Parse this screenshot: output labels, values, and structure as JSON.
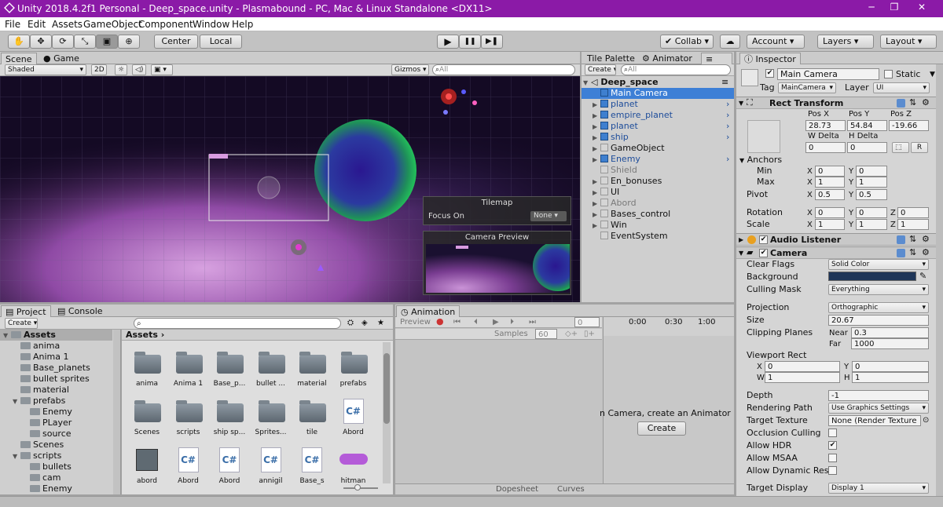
{
  "window": {
    "title": "Unity 2018.4.2f1 Personal - Deep_space.unity - Plasmabound - PC, Mac & Linux Standalone <DX11>",
    "minimize": "─",
    "restore": "❐",
    "close": "✕"
  },
  "menu": [
    "File",
    "Edit",
    "Assets",
    "GameObject",
    "Component",
    "Window",
    "Help"
  ],
  "toolbar": {
    "tools": [
      "✋",
      "✥",
      "⟳",
      "⤡",
      "▣",
      "⊕"
    ],
    "center": "Center",
    "local": "Local",
    "play": "▶",
    "pause": "❚❚",
    "step": "▶❚",
    "collab": "Collab",
    "account": "Account",
    "layers": "Layers",
    "layout": "Layout"
  },
  "scene": {
    "tab_scene": "Scene",
    "tab_game": "Game",
    "shading": "Shaded",
    "mode2d": "2D",
    "gizmos": "Gizmos",
    "search": "All",
    "tilemap_title": "Tilemap",
    "focus_on": "Focus On",
    "focus_value": "None",
    "camera_preview": "Camera Preview"
  },
  "hierarchy": {
    "tab_tile": "Tile Palette",
    "tab_animator": "Animator",
    "tab_hier": "Hierarchy",
    "create": "Create",
    "search": "All",
    "scene": "Deep_space",
    "items": [
      {
        "name": "Main Camera",
        "sel": true,
        "blue": true,
        "arrow": false
      },
      {
        "name": "planet",
        "blue": true,
        "arrow": true,
        "ra": true
      },
      {
        "name": "empire_planet",
        "blue": true,
        "arrow": true,
        "ra": true
      },
      {
        "name": "planet",
        "blue": true,
        "arrow": true,
        "ra": true
      },
      {
        "name": "ship",
        "blue": true,
        "arrow": true,
        "ra": true
      },
      {
        "name": "GameObject",
        "arrow": true
      },
      {
        "name": "Enemy",
        "blue": true,
        "arrow": true,
        "ra": true
      },
      {
        "name": "Shield",
        "dim": true,
        "arrow": false
      },
      {
        "name": "En_bonuses",
        "arrow": true
      },
      {
        "name": "UI",
        "arrow": true
      },
      {
        "name": "Abord",
        "dim": true,
        "arrow": true
      },
      {
        "name": "Bases_control",
        "arrow": true
      },
      {
        "name": "Win",
        "arrow": true
      },
      {
        "name": "EventSystem",
        "arrow": false
      }
    ]
  },
  "project": {
    "tab_project": "Project",
    "tab_console": "Console",
    "create": "Create",
    "breadcrumb": "Assets",
    "tree": [
      {
        "name": "Assets",
        "level": 0,
        "open": true,
        "sel": true
      },
      {
        "name": "anima",
        "level": 1
      },
      {
        "name": "Anima 1",
        "level": 1
      },
      {
        "name": "Base_planets",
        "level": 1
      },
      {
        "name": "bullet sprites",
        "level": 1
      },
      {
        "name": "material",
        "level": 1
      },
      {
        "name": "prefabs",
        "level": 1,
        "open": true
      },
      {
        "name": "Enemy",
        "level": 2
      },
      {
        "name": "PLayer",
        "level": 2
      },
      {
        "name": "source",
        "level": 2
      },
      {
        "name": "Scenes",
        "level": 1
      },
      {
        "name": "scripts",
        "level": 1,
        "open": true
      },
      {
        "name": "bullets",
        "level": 2
      },
      {
        "name": "cam",
        "level": 2
      },
      {
        "name": "Enemy",
        "level": 2
      }
    ],
    "grid": [
      {
        "label": "anima",
        "kind": "folder"
      },
      {
        "label": "Anima 1",
        "kind": "folder"
      },
      {
        "label": "Base_p...",
        "kind": "folder"
      },
      {
        "label": "bullet ...",
        "kind": "folder"
      },
      {
        "label": "material",
        "kind": "folder"
      },
      {
        "label": "prefabs",
        "kind": "folder"
      },
      {
        "label": "Scenes",
        "kind": "folder"
      },
      {
        "label": "scripts",
        "kind": "folder"
      },
      {
        "label": "ship sp...",
        "kind": "folder"
      },
      {
        "label": "Sprites...",
        "kind": "folder"
      },
      {
        "label": "tile",
        "kind": "folder"
      },
      {
        "label": "Abord",
        "kind": "cs"
      },
      {
        "label": "abord",
        "kind": "img"
      },
      {
        "label": "Abord",
        "kind": "cs"
      },
      {
        "label": "Abord",
        "kind": "cs"
      },
      {
        "label": "annigil",
        "kind": "cs"
      },
      {
        "label": "Base_s",
        "kind": "cs"
      },
      {
        "label": "hitman",
        "kind": "hit"
      }
    ],
    "cs_glyph": "C#"
  },
  "animation": {
    "tab": "Animation",
    "preview": "Preview",
    "frame": "0",
    "samples_label": "Samples",
    "samples": "60",
    "ticks": [
      "0:00",
      "0:30",
      "1:00"
    ],
    "message": "n Camera, create an Animator",
    "create": "Create",
    "dopesheet": "Dopesheet",
    "curves": "Curves"
  },
  "inspector": {
    "tab": "Inspector",
    "name": "Main Camera",
    "static": "Static",
    "tag_label": "Tag",
    "tag": "MainCamera",
    "layer_label": "Layer",
    "layer": "UI",
    "rect": {
      "title": "Rect Transform",
      "posx_l": "Pos X",
      "posy_l": "Pos Y",
      "posz_l": "Pos Z",
      "posx": "28.73",
      "posy": "54.84",
      "posz": "-19.66",
      "wd_l": "W Delta",
      "hd_l": "H Delta",
      "wd": "0",
      "hd": "0",
      "r": "R",
      "anchors": "Anchors",
      "min": "Min",
      "max": "Max",
      "minx": "0",
      "miny": "0",
      "maxx": "1",
      "maxy": "1",
      "pivot": "Pivot",
      "pivx": "0.5",
      "pivy": "0.5",
      "rotation": "Rotation",
      "rotx": "0",
      "roty": "0",
      "rotz": "0",
      "scale": "Scale",
      "scx": "1",
      "scy": "1",
      "scz": "1",
      "x": "X",
      "y": "Y",
      "z": "Z"
    },
    "audio": "Audio Listener",
    "camera": {
      "title": "Camera",
      "clear_flags_l": "Clear Flags",
      "clear_flags": "Solid Color",
      "background_l": "Background",
      "background_color": "#1e3558",
      "culling_l": "Culling Mask",
      "culling": "Everything",
      "projection_l": "Projection",
      "projection": "Orthographic",
      "size_l": "Size",
      "size": "20.67",
      "clipping_l": "Clipping Planes",
      "near_l": "Near",
      "near": "0.3",
      "far_l": "Far",
      "far": "1000",
      "viewport_l": "Viewport Rect",
      "vx_l": "X",
      "vx": "0",
      "vy_l": "Y",
      "vy": "0",
      "vw_l": "W",
      "vw": "1",
      "vh_l": "H",
      "vh": "1",
      "depth_l": "Depth",
      "depth": "-1",
      "rpath_l": "Rendering Path",
      "rpath": "Use Graphics Settings",
      "ttex_l": "Target Texture",
      "ttex": "None (Render Texture",
      "occl_l": "Occlusion Culling",
      "hdr_l": "Allow HDR",
      "msaa_l": "Allow MSAA",
      "dyn_l": "Allow Dynamic Reso",
      "tdisp_l": "Target Display",
      "tdisp": "Display 1"
    }
  }
}
